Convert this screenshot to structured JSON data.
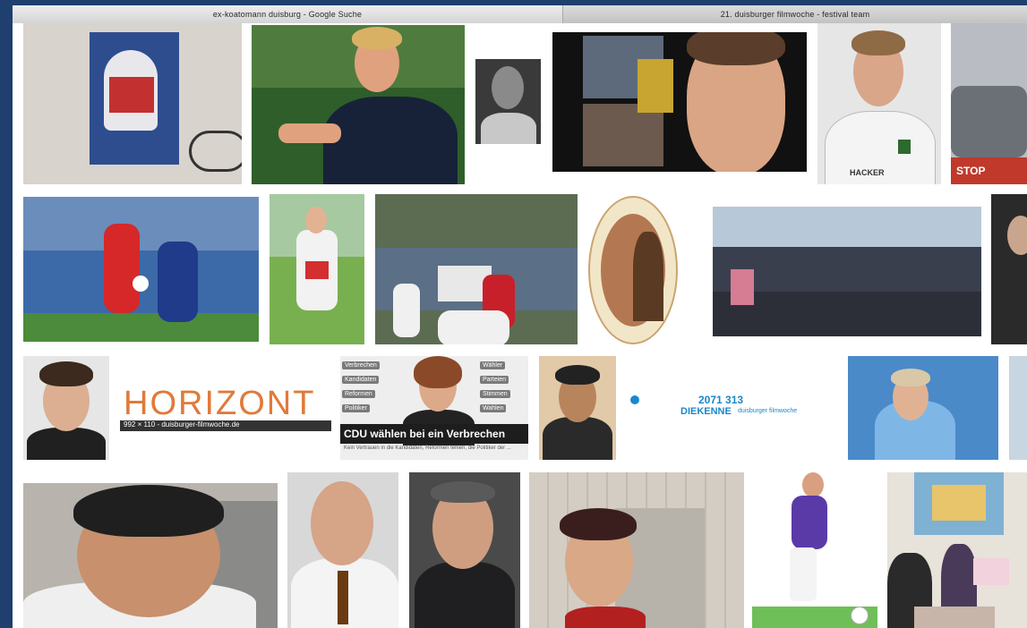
{
  "browser": {
    "tab_active": "ex-koatomann duisburg - Google Suche",
    "tab_inactive": "21. duisburger filmwoche - festival team"
  },
  "results": {
    "horizont_title": "HORIZONT",
    "horizont_caption": "992 × 110 - duisburger-filmwoche.de",
    "article_headline": "CDU wählen bei ein Verbrechen",
    "article_subtext": "Kein Vertrauen in die Kandidaten, Reformen fehlen, die Politiker der ...",
    "article_buttons_left": [
      "Verbrechen",
      "Kandidaten",
      "Reformen",
      "Politiker"
    ],
    "article_buttons_right": [
      "Wähler",
      "Parteien",
      "Stimmen",
      "Wahlen"
    ],
    "logo_line1": "2071 313",
    "logo_line2": "DIEKENNE",
    "logo_brand": "duisburger filmwoche",
    "store_sign": "STOP",
    "jersey_text": "HACKER"
  },
  "colors": {
    "page_bg": "#1f3f6e",
    "canvas_bg": "#ffffff",
    "horizont_orange": "#e07a3a"
  }
}
